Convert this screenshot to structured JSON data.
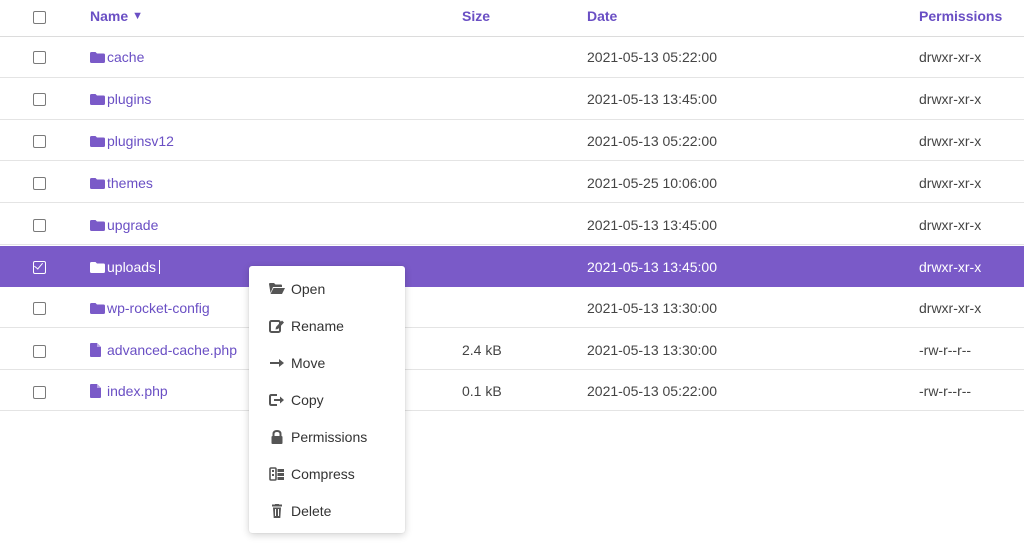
{
  "header": {
    "name": "Name",
    "name_sort": "▼",
    "size": "Size",
    "date": "Date",
    "permissions": "Permissions"
  },
  "files": [
    {
      "name": "cache",
      "type": "folder",
      "size": "",
      "date": "2021-05-13 05:22:00",
      "perm": "drwxr-xr-x",
      "selected": false
    },
    {
      "name": "plugins",
      "type": "folder",
      "size": "",
      "date": "2021-05-13 13:45:00",
      "perm": "drwxr-xr-x",
      "selected": false
    },
    {
      "name": "pluginsv12",
      "type": "folder",
      "size": "",
      "date": "2021-05-13 05:22:00",
      "perm": "drwxr-xr-x",
      "selected": false
    },
    {
      "name": "themes",
      "type": "folder",
      "size": "",
      "date": "2021-05-25 10:06:00",
      "perm": "drwxr-xr-x",
      "selected": false
    },
    {
      "name": "upgrade",
      "type": "folder",
      "size": "",
      "date": "2021-05-13 13:45:00",
      "perm": "drwxr-xr-x",
      "selected": false
    },
    {
      "name": "uploads",
      "type": "folder",
      "size": "",
      "date": "2021-05-13 13:45:00",
      "perm": "drwxr-xr-x",
      "selected": true
    },
    {
      "name": "wp-rocket-config",
      "type": "folder",
      "size": "",
      "date": "2021-05-13 13:30:00",
      "perm": "drwxr-xr-x",
      "selected": false
    },
    {
      "name": "advanced-cache.php",
      "type": "file",
      "size": "2.4 kB",
      "date": "2021-05-13 13:30:00",
      "perm": "-rw-r--r--",
      "selected": false
    },
    {
      "name": "index.php",
      "type": "file",
      "size": "0.1 kB",
      "date": "2021-05-13 05:22:00",
      "perm": "-rw-r--r--",
      "selected": false
    }
  ],
  "context_menu": {
    "items": [
      {
        "label": "Open",
        "icon": "folder-open-icon"
      },
      {
        "label": "Rename",
        "icon": "rename-icon"
      },
      {
        "label": "Move",
        "icon": "arrow-right-icon"
      },
      {
        "label": "Copy",
        "icon": "copy-icon"
      },
      {
        "label": "Permissions",
        "icon": "lock-icon"
      },
      {
        "label": "Compress",
        "icon": "compress-icon"
      },
      {
        "label": "Delete",
        "icon": "trash-icon"
      }
    ]
  },
  "colors": {
    "accent": "#7a5ac8",
    "link": "#6a4fc4"
  }
}
